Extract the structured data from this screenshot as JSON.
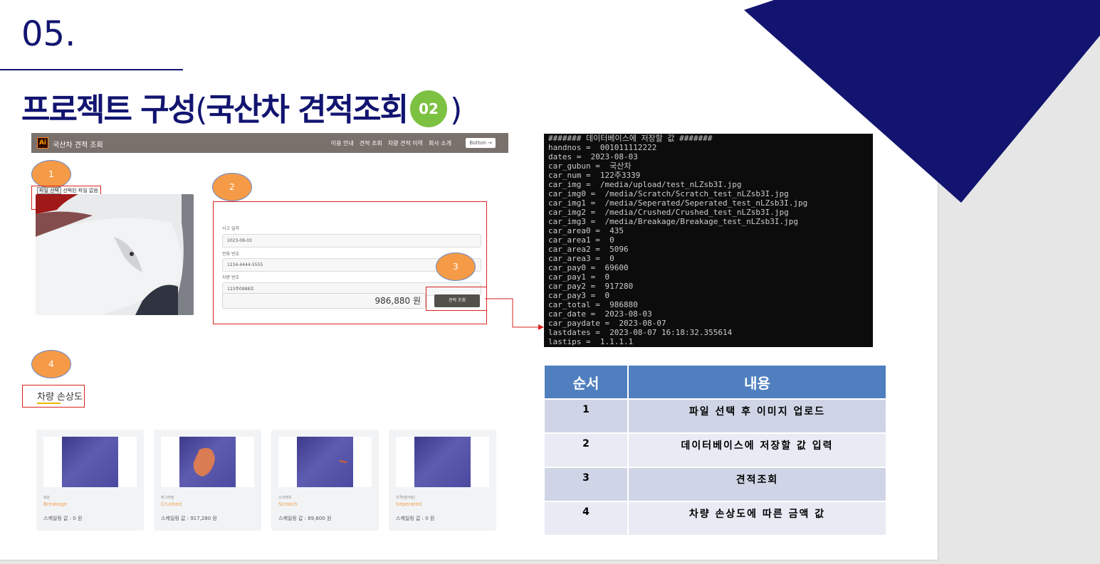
{
  "slide": {
    "section_number": "05.",
    "title_main": "프로젝트 구성",
    "title_paren_open": "(",
    "title_sub": "국산차 견적조회",
    "badge": "02",
    "title_paren_close": ")",
    "accent_color": "#121470",
    "badge_color": "#7dc142"
  },
  "app": {
    "logo": "Ai",
    "brand": "국산차 견적 조회",
    "nav_links": [
      "이용 안내",
      "견적 조회",
      "차량 견적 이력",
      "회사 소개"
    ],
    "nav_button": "Button →",
    "file_button": "파일 선택",
    "file_status": "선택된 파일 없음",
    "form": {
      "date_label": "사고 일자",
      "date_value": "2023-08-03",
      "phone_label": "전화 번호",
      "phone_value": "1234-4444-5555",
      "car_label": "차량 번호",
      "car_value": "123주0988호"
    },
    "total": "986,880 원",
    "quote_button": "견적 조회",
    "damage_title": "차량 손상도",
    "cards": [
      {
        "ko": "파손",
        "en": "Breakage",
        "price": "스케일링 값 : 0 원"
      },
      {
        "ko": "찌그러짐",
        "en": "Crushed",
        "price": "스케일링 값 : 917,280 원"
      },
      {
        "ko": "스크래치",
        "en": "Scratch",
        "price": "스케일링 값 : 69,600 원"
      },
      {
        "ko": "이격(벌어짐)",
        "en": "Seperated",
        "price": "스케일링 값 : 0 원"
      }
    ]
  },
  "markers": [
    "1",
    "2",
    "3",
    "4"
  ],
  "console": [
    "####### 데이터베이스에 저장할 값 #######",
    "handnos =  001011112222",
    "dates =  2023-08-03",
    "car_gubun =  국산차",
    "car_num =  122주3339",
    "car_img =  /media/upload/test_nLZsb3I.jpg",
    "car_img0 =  /media/Scratch/Scratch_test_nLZsb3I.jpg",
    "car_img1 =  /media/Seperated/Seperated_test_nLZsb3I.jpg",
    "car_img2 =  /media/Crushed/Crushed_test_nLZsb3I.jpg",
    "car_img3 =  /media/Breakage/Breakage_test_nLZsb3I.jpg",
    "car_area0 =  435",
    "car_area1 =  0",
    "car_area2 =  5096",
    "car_area3 =  0",
    "car_pay0 =  69600",
    "car_pay1 =  0",
    "car_pay2 =  917280",
    "car_pay3 =  0",
    "car_total =  986880",
    "car_date =  2023-08-03",
    "car_paydate =  2023-08-07",
    "lastdates =  2023-08-07 16:18:32.355614",
    "lastips =  1.1.1.1"
  ],
  "table": {
    "headers": [
      "순서",
      "내용"
    ],
    "rows": [
      [
        "1",
        "파일 선택 후 이미지 업로드"
      ],
      [
        "2",
        "데이터베이스에 저장할 값 입력"
      ],
      [
        "3",
        "견적조회"
      ],
      [
        "4",
        "차량 손상도에 따른 금액 값"
      ]
    ]
  }
}
